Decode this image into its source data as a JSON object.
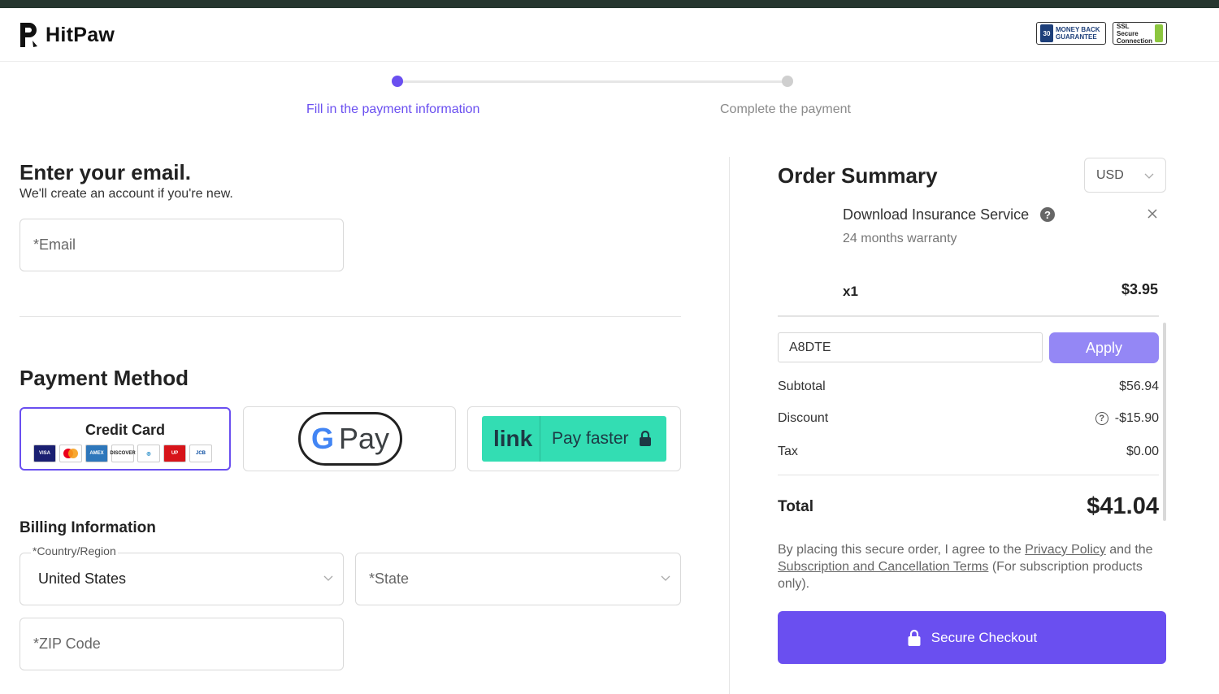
{
  "brand": {
    "name": "HitPaw"
  },
  "badges": {
    "money_back": {
      "number": "30",
      "line1": "MONEY BACK",
      "line2": "GUARANTEE"
    },
    "ssl": {
      "line1": "SSL",
      "line2": "Secure",
      "line3": "Connection"
    }
  },
  "stepper": {
    "steps": [
      {
        "label": "Fill in the payment information",
        "active": true
      },
      {
        "label": "Complete the payment",
        "active": false
      }
    ],
    "colors": {
      "active": "#6a4ff0",
      "inactive": "#cfcfcf"
    }
  },
  "email_section": {
    "heading": "Enter your email.",
    "subtext": "We'll create an account if you're new.",
    "email_placeholder": "*Email"
  },
  "payment_method": {
    "heading": "Payment Method",
    "credit_card_label": "Credit Card",
    "card_logos": [
      "VISA",
      "Mastercard",
      "AMEX",
      "DISCOVER",
      "Diners Club",
      "UnionPay",
      "JCB"
    ],
    "gpay": {
      "letter": "G",
      "label": "Pay"
    },
    "link": {
      "brand": "link",
      "label": "Pay faster"
    },
    "selected": "Credit Card"
  },
  "billing": {
    "heading": "Billing Information",
    "country_label": "*Country/Region",
    "country_value": "United States",
    "state_placeholder": "*State",
    "zip_placeholder": "*ZIP Code"
  },
  "order_summary": {
    "heading": "Order Summary",
    "currency": "USD",
    "product": {
      "name": "Download Insurance Service",
      "warranty": "24 months warranty",
      "qty": "x1",
      "price": "$3.95"
    },
    "coupon_value": "A8DTE",
    "apply_label": "Apply",
    "subtotal_label": "Subtotal",
    "subtotal_value": "$56.94",
    "discount_label": "Discount",
    "discount_value": "-$15.90",
    "tax_label": "Tax",
    "tax_value": "$0.00",
    "total_label": "Total",
    "total_value": "$41.04",
    "legal": {
      "prefix": "By placing this secure order, I agree to the ",
      "privacy_link": "Privacy Policy",
      "middle": " and the ",
      "terms_link": "Subscription and Cancellation Terms",
      "suffix": " (For subscription products only)."
    },
    "checkout_label": "Secure Checkout",
    "accent": "#6a4ff0",
    "apply_color": "#9487f5"
  }
}
